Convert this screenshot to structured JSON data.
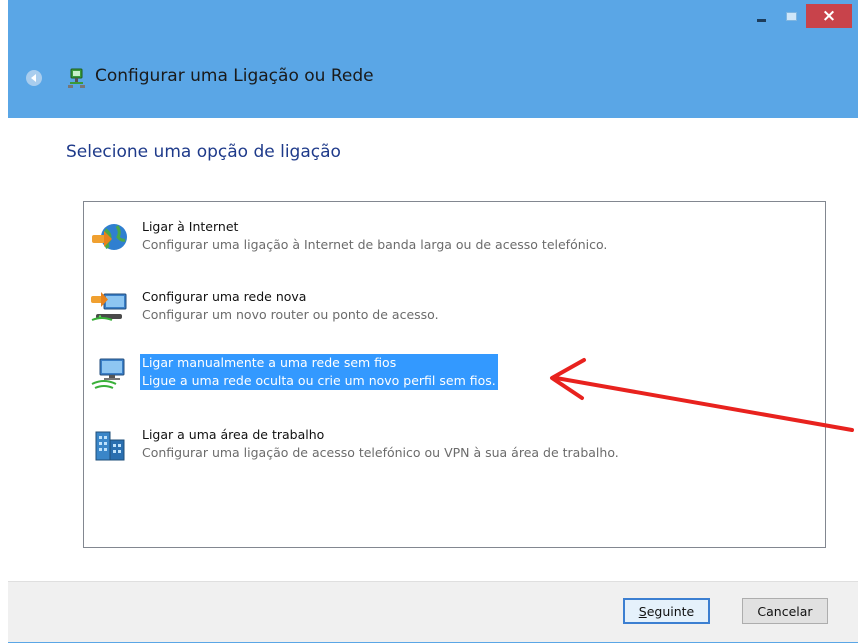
{
  "window": {
    "title": "Configurar uma Ligação ou Rede",
    "controls": {
      "minimize_icon": "minimize-icon",
      "maximize_icon": "maximize-icon",
      "close_glyph": "×"
    }
  },
  "heading": "Selecione uma opção de ligação",
  "options": [
    {
      "title": "Ligar à Internet",
      "description": "Configurar uma ligação à Internet de banda larga ou de acesso telefónico.",
      "icon": "internet-globe-icon",
      "selected": false
    },
    {
      "title": "Configurar uma rede nova",
      "description": "Configurar um novo router ou ponto de acesso.",
      "icon": "new-network-router-icon",
      "selected": false
    },
    {
      "title": "Ligar manualmente a uma rede sem fios",
      "description": "Ligue a uma rede oculta ou crie um novo perfil sem fios.",
      "icon": "wireless-network-icon",
      "selected": true
    },
    {
      "title": "Ligar a uma área de trabalho",
      "description": "Configurar uma ligação de acesso telefónico ou VPN à sua área de trabalho.",
      "icon": "workplace-vpn-icon",
      "selected": false
    }
  ],
  "buttons": {
    "next_mnemonic": "S",
    "next_rest": "eguinte",
    "cancel": "Cancelar"
  },
  "annotation": {
    "arrow_color": "#e8221e"
  },
  "colors": {
    "titlebar": "#5aa6e6",
    "selection": "#3399ff",
    "heading": "#1e3a8a",
    "close_button": "#c8434b"
  }
}
